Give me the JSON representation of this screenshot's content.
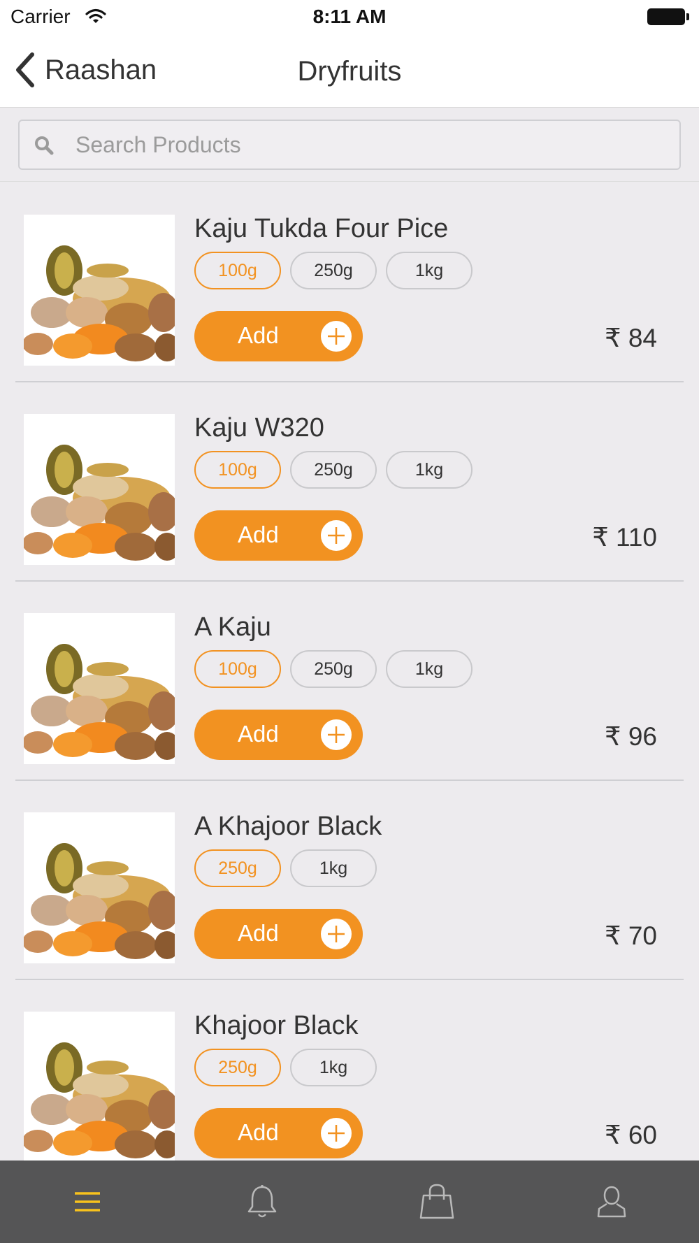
{
  "status_bar": {
    "carrier": "Carrier",
    "time": "8:11 AM"
  },
  "nav": {
    "back_label": "Raashan",
    "title": "Dryfruits"
  },
  "search": {
    "placeholder": "Search Products",
    "value": ""
  },
  "add_label": "Add",
  "colors": {
    "accent": "#f29221",
    "background": "#edebee",
    "tab_bar": "#555556",
    "tab_active": "#f7c21d"
  },
  "products": [
    {
      "name": "Kaju Tukda Four Pice",
      "sizes": [
        "100g",
        "250g",
        "1kg"
      ],
      "selected": "100g",
      "price": "₹ 84"
    },
    {
      "name": "Kaju W320",
      "sizes": [
        "100g",
        "250g",
        "1kg"
      ],
      "selected": "100g",
      "price": "₹ 110"
    },
    {
      "name": "A Kaju",
      "sizes": [
        "100g",
        "250g",
        "1kg"
      ],
      "selected": "100g",
      "price": "₹ 96"
    },
    {
      "name": "A Khajoor Black",
      "sizes": [
        "250g",
        "1kg"
      ],
      "selected": "250g",
      "price": "₹ 70"
    },
    {
      "name": "Khajoor Black",
      "sizes": [
        "250g",
        "1kg"
      ],
      "selected": "250g",
      "price": "₹ 60"
    }
  ],
  "tabs": [
    {
      "icon": "menu-icon",
      "active": true
    },
    {
      "icon": "bell-icon",
      "active": false
    },
    {
      "icon": "shopping-bag-icon",
      "active": false
    },
    {
      "icon": "user-icon",
      "active": false
    }
  ]
}
